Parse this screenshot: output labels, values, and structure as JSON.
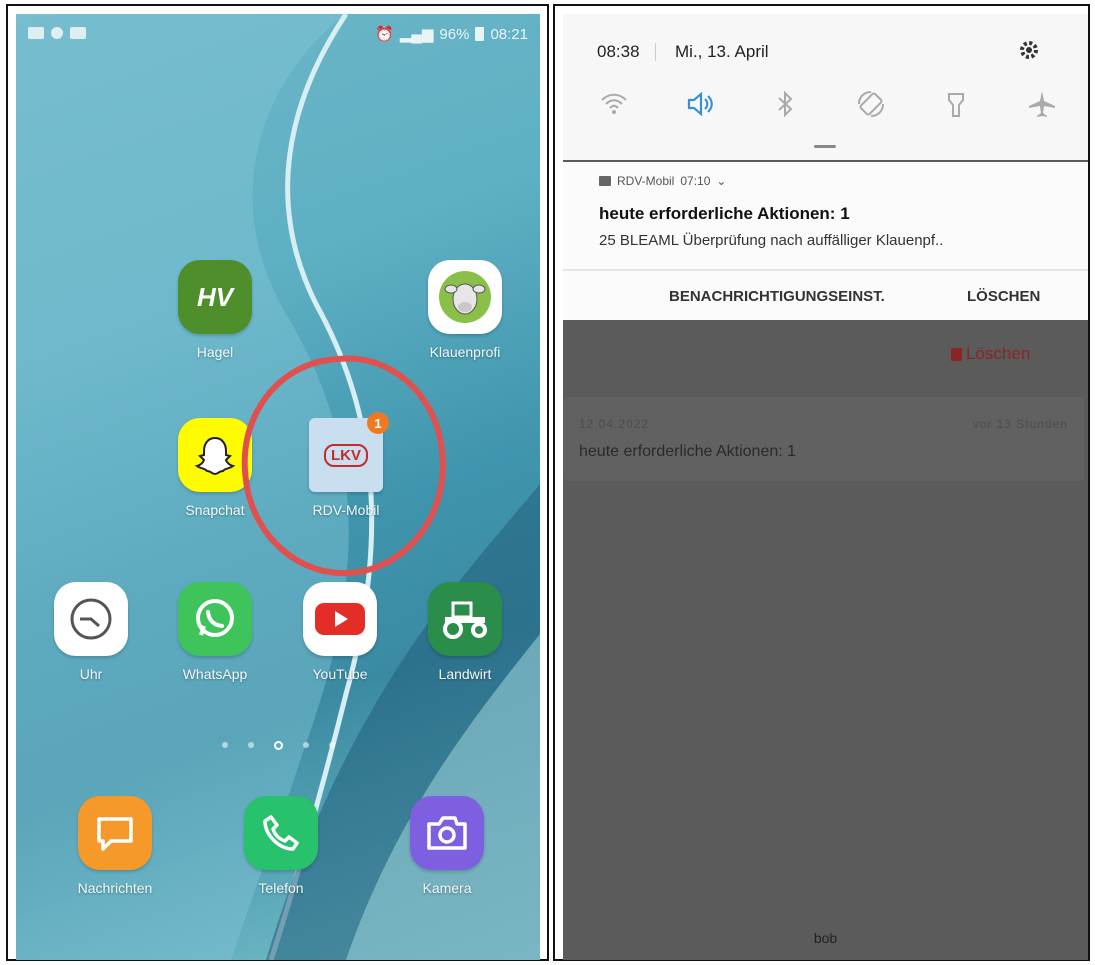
{
  "home": {
    "status": {
      "battery": "96%",
      "time": "08:21"
    },
    "apps": [
      {
        "label": "Hagel",
        "icon": "hagel-icon",
        "icon_text": "HV"
      },
      {
        "label": "Klauenprofi",
        "icon": "cow-head-icon"
      },
      {
        "label": "Snapchat",
        "icon": "snapchat-ghost-icon"
      },
      {
        "label": "RDV-Mobil",
        "icon": "lkv-icon",
        "icon_text": "LKV",
        "badge": "1"
      },
      {
        "label": "Uhr",
        "icon": "clock-icon"
      },
      {
        "label": "WhatsApp",
        "icon": "whatsapp-icon"
      },
      {
        "label": "YouTube",
        "icon": "youtube-icon"
      },
      {
        "label": "Landwirt",
        "icon": "tractor-icon"
      },
      {
        "label": "Nachrichten",
        "icon": "message-icon"
      },
      {
        "label": "Telefon",
        "icon": "phone-icon"
      },
      {
        "label": "Kamera",
        "icon": "camera-icon"
      }
    ]
  },
  "panel": {
    "time": "08:38",
    "date": "Mi., 13. April",
    "quick_toggles": [
      "wifi-icon",
      "sound-icon",
      "bluetooth-icon",
      "auto-rotate-icon",
      "flashlight-icon",
      "airplane-icon"
    ],
    "notification": {
      "app": "RDV-Mobil",
      "time": "07:10",
      "title": "heute erforderliche Aktionen: 1",
      "body": "25 BLEAML   Überprüfung nach auffälliger Klauenpf.."
    },
    "actions": {
      "settings": "BENACHRICHTIGUNGSEINST.",
      "clear": "LÖSCHEN"
    },
    "background_app": {
      "delete_label": "Löschen",
      "card": {
        "date": "12.04.2022",
        "ago": "vor 13 Stunden",
        "title": "heute erforderliche Aktionen: 1"
      },
      "footer": "bob"
    }
  }
}
